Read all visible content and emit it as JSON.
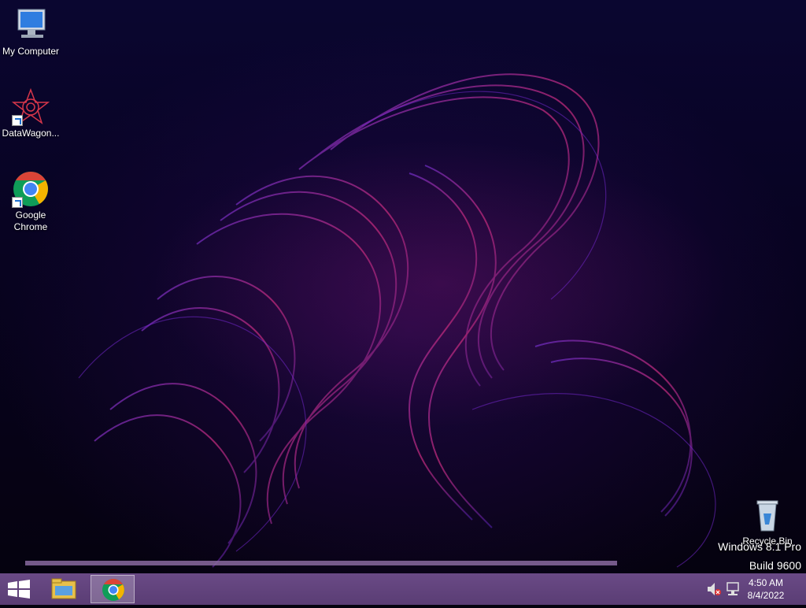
{
  "desktop_icons": [
    {
      "label": "My Computer",
      "icon": "computer-icon"
    },
    {
      "label": "DataWagon...",
      "icon": "datawagon-icon"
    },
    {
      "label": "Google Chrome",
      "icon": "chrome-icon"
    },
    {
      "label": "Recycle Bin",
      "icon": "recycle-bin-icon"
    }
  ],
  "watermark": {
    "line1": "Windows 8.1 Pro",
    "line2": "Build 9600"
  },
  "taskbar": {
    "start_icon": "windows-logo-icon",
    "pinned": [
      {
        "name": "File Explorer",
        "icon": "file-explorer-icon"
      },
      {
        "name": "Google Chrome",
        "icon": "chrome-icon",
        "active": true
      }
    ],
    "tray_icons": [
      "volume-muted-icon",
      "network-icon"
    ],
    "time": "4:50 AM",
    "date": "8/4/2022"
  },
  "colors": {
    "taskbar": "#5f4279",
    "chrome_red": "#db4437",
    "chrome_yellow": "#f4b400",
    "chrome_green": "#0f9d58",
    "chrome_blue": "#4285f4"
  }
}
